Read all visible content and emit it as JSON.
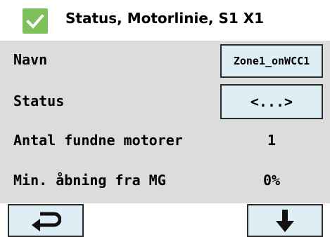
{
  "header": {
    "title": "Status, Motorlinie, S1 X1",
    "checkbox_color": "#7ec05a",
    "checkbox_icon": "check-icon"
  },
  "rows": [
    {
      "label": "Navn",
      "value": "Zone1_onWCC1",
      "type": "button"
    },
    {
      "label": "Status",
      "value": "<...>",
      "type": "button"
    },
    {
      "label": "Antal fundne motorer",
      "value": "1",
      "type": "text"
    },
    {
      "label": "Min. åbning fra MG",
      "value": "0%",
      "type": "text"
    }
  ],
  "nav": {
    "back_icon": "return-arrow-icon",
    "down_icon": "down-arrow-icon"
  },
  "colors": {
    "content_background": "#dcdcdc",
    "button_fill": "#ddeef4",
    "button_border": "#2b2b2b"
  }
}
